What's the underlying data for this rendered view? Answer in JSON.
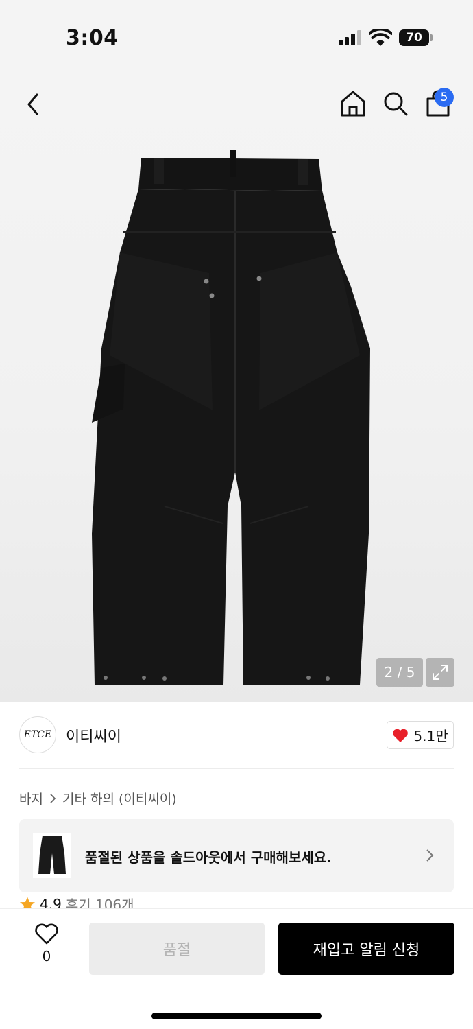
{
  "status_bar": {
    "time": "3:04",
    "battery": "70"
  },
  "header": {
    "cart_count": "5"
  },
  "gallery": {
    "counter": "2 / 5"
  },
  "brand": {
    "logo_text": "ETCE",
    "name": "이티씨이",
    "likes": "5.1만"
  },
  "breadcrumb": {
    "category": "바지",
    "subcategory": "기타 하의 (이티씨이)"
  },
  "soldout_banner": {
    "text": "품절된 상품을 솔드아웃에서 구매해보세요."
  },
  "rating": {
    "score": "4.9",
    "reviews": "후기 106개"
  },
  "bottom_bar": {
    "wish_count": "0",
    "soldout_label": "품절",
    "restock_label": "재입고 알림 신청"
  },
  "colors": {
    "accent_blue": "#2a6bf2",
    "heart_red": "#e8202a",
    "star_orange": "#f5a623",
    "primary_black": "#000000"
  }
}
